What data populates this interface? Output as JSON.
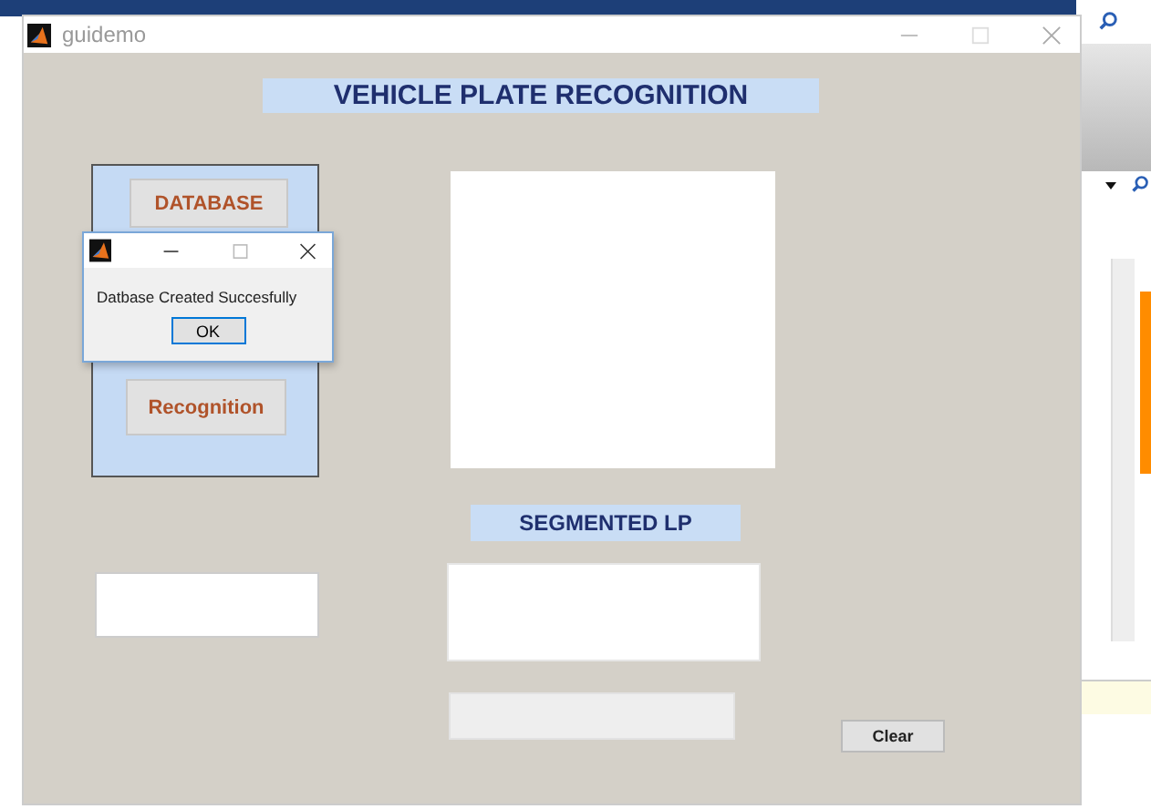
{
  "window": {
    "title": "guidemo"
  },
  "heading": "VEHICLE PLATE RECOGNITION",
  "panel_buttons": [
    {
      "label": "DATABASE"
    },
    {
      "label": "Recognition"
    }
  ],
  "segmented_label": "SEGMENTED LP",
  "clear_button": "Clear",
  "dialog": {
    "message": "Datbase Created Succesfully",
    "button": "OK"
  }
}
